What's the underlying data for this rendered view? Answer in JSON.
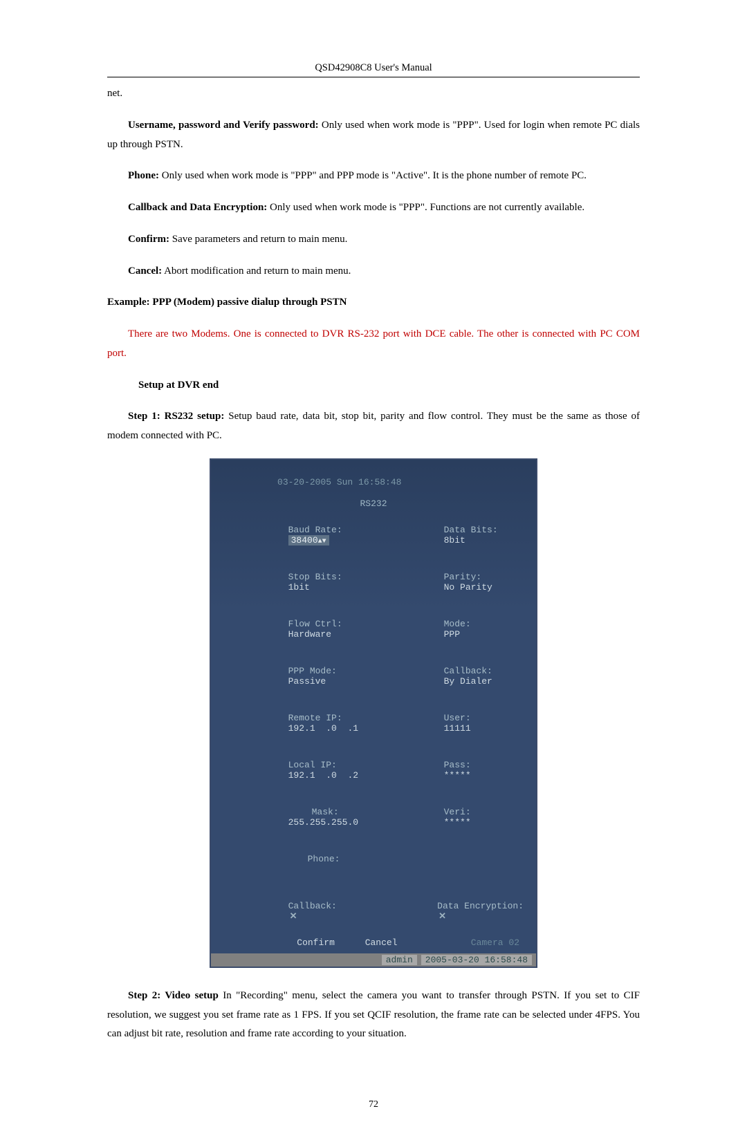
{
  "header": {
    "title": "QSD42908C8 User's Manual"
  },
  "body": {
    "net_continuation": "net.",
    "p1a": "Username, password and Verify password:",
    "p1b": " Only used when work mode is \"PPP\". Used for login when remote PC dials up through PSTN.",
    "p2a": "Phone:",
    "p2b": " Only used when work mode is \"PPP\" and PPP mode is \"Active\". It is the phone number of remote PC.",
    "p3a": "Callback and Data Encryption:",
    "p3b": " Only used when work mode is \"PPP\". Functions are not currently available.",
    "p4a": "Confirm:",
    "p4b": " Save parameters and return to main menu.",
    "p5a": "Cancel:",
    "p5b": " Abort modification and return to main menu.",
    "example_heading": "Example: PPP (Modem) passive dialup through PSTN",
    "red_para": "There are two Modems. One is connected to DVR RS-232 port with DCE cable. The other is connected with PC COM port.",
    "setup_heading": "Setup at DVR end",
    "step1a": "Step 1: RS232 setup:",
    "step1b": " Setup baud rate, data bit, stop bit, parity and flow control. They must be the same as those of modem connected with PC.",
    "step2a": "Step 2: Video setup",
    "step2b": " In \"Recording\" menu, select the camera you want to transfer through PSTN. If you set to CIF resolution, we suggest you set frame rate as 1 FPS. If you set QCIF resolution, the frame rate can be selected under 4FPS. You can adjust bit rate, resolution and frame rate according to your situation."
  },
  "rs232": {
    "bg_date": "03-20-2005 Sun 16:58:48",
    "title": "RS232",
    "rows": {
      "baud_label": "Baud Rate:",
      "baud_value": "38400",
      "databits_label": "Data Bits:",
      "databits_value": "8bit",
      "stopbits_label": "Stop Bits:",
      "stopbits_value": "1bit",
      "parity_label": "Parity:",
      "parity_value": "No Parity",
      "flow_label": "Flow Ctrl:",
      "flow_value": "Hardware",
      "mode_label": "Mode:",
      "mode_value": "PPP",
      "pppmode_label": "PPP Mode:",
      "pppmode_value": "Passive",
      "callback_label": "Callback:",
      "callback_value": "By Dialer",
      "remoteip_label": "Remote IP:",
      "remoteip_value": "192.1  .0  .1",
      "user_label": "User:",
      "user_value": "11111",
      "localip_label": "Local IP:",
      "localip_value": "192.1  .0  .2",
      "pass_label": "Pass:",
      "pass_value": "*****",
      "mask_label": "Mask:",
      "mask_value": "255.255.255.0",
      "veri_label": "Veri:",
      "veri_value": "*****",
      "phone_label": "Phone:",
      "phone_value": "",
      "cb_label": "Callback:",
      "dataenc_label": "Data Encryption:"
    },
    "buttons": {
      "confirm": "Confirm",
      "cancel": "Cancel"
    },
    "camera": "Camera 02",
    "status": {
      "admin": "admin",
      "datetime": "2005-03-20 16:58:48"
    }
  },
  "footer": {
    "page_number": "72"
  }
}
